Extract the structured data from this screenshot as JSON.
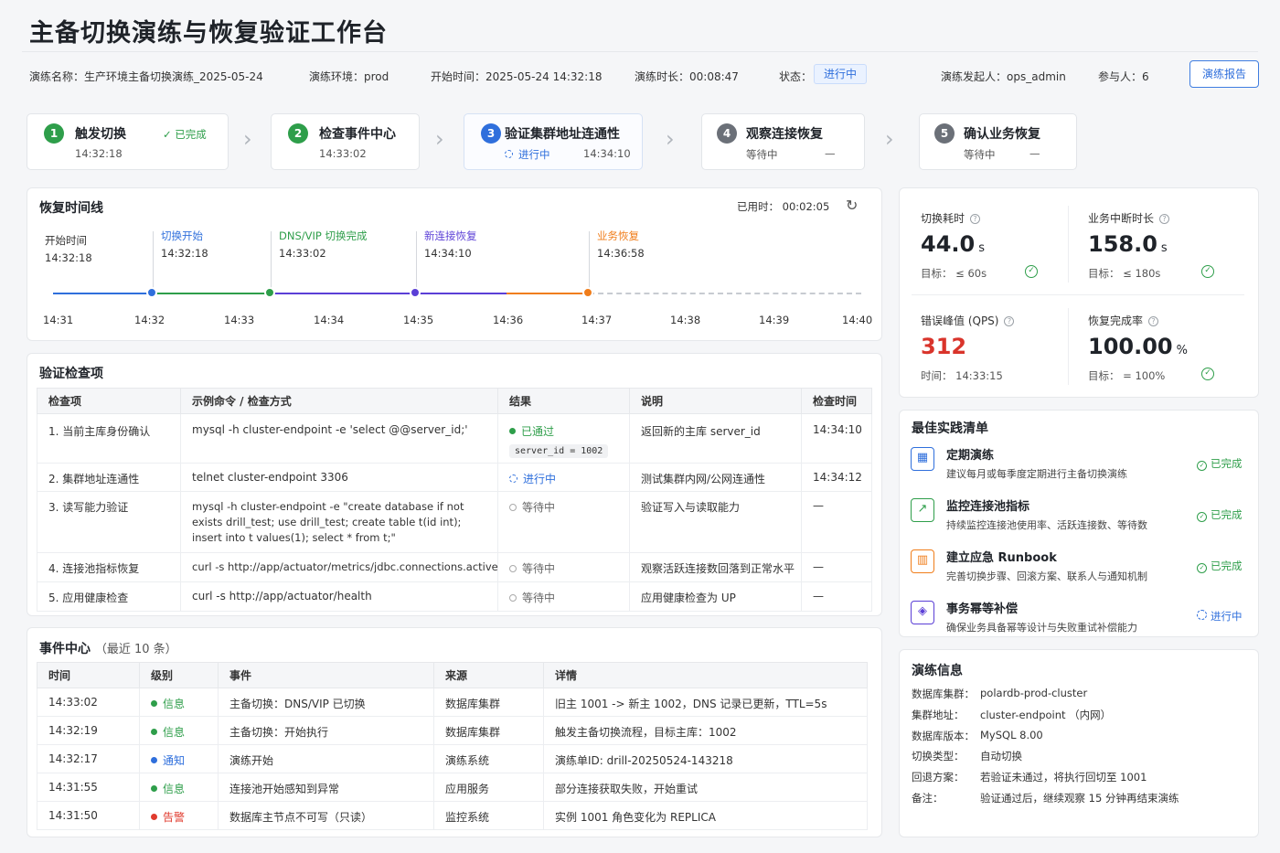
{
  "header": {
    "title": "主备切换演练与恢复验证工作台",
    "drill_name_label": "演练名称：",
    "drill_name": "生产环境主备切换演练_2025-05-24",
    "env_label": "演练环境：",
    "env": "prod",
    "start_label": "开始时间：",
    "start": "2025-05-24 14:32:18",
    "duration_label": "演练时长：",
    "duration": "00:08:47",
    "status_label": "状态：",
    "status": "进行中",
    "initiator_label": "演练发起人：",
    "initiator": "ops_admin",
    "participants_label": "参与人：",
    "participants": "6",
    "report_button": "演练报告"
  },
  "steps": [
    {
      "num": "1",
      "name": "触发切换",
      "time": "14:32:18",
      "status": "已完成",
      "color": "#2e9e4a"
    },
    {
      "num": "2",
      "name": "检查事件中心",
      "time": "14:33:02",
      "status": "",
      "color": "#2e9e4a"
    },
    {
      "num": "3",
      "name": "验证集群地址连通性",
      "status": "进行中",
      "time": "14:34:10",
      "color": "#2f6fdc"
    },
    {
      "num": "4",
      "name": "观察连接恢复",
      "status": "等待中",
      "time": "—",
      "color": "#6b7078"
    },
    {
      "num": "5",
      "name": "确认业务恢复",
      "status": "等待中",
      "time": "—",
      "color": "#6b7078"
    }
  ],
  "timeline": {
    "title": "恢复时间线",
    "elapsed_label": "已用时：",
    "elapsed": "00:02:05",
    "start_label": "开始时间",
    "start_time": "14:32:18",
    "events": [
      {
        "label": "切换开始",
        "time": "14:32:18",
        "color": "#2f6fdc"
      },
      {
        "label": "DNS/VIP 切换完成",
        "time": "14:33:02",
        "color": "#2e9e4a"
      },
      {
        "label": "新连接恢复",
        "time": "14:34:10",
        "color": "#5b3fd6"
      },
      {
        "label": "业务恢复",
        "time": "14:36:58",
        "color": "#f07d1a"
      }
    ],
    "ticks": [
      "14:31",
      "14:32",
      "14:33",
      "14:34",
      "14:35",
      "14:36",
      "14:37",
      "14:38",
      "14:39",
      "14:40"
    ]
  },
  "metrics": {
    "switch": {
      "label": "切换耗时",
      "value": "44.0",
      "unit": "s",
      "target_label": "目标：",
      "target": "≤ 60s"
    },
    "interrupt": {
      "label": "业务中断时长",
      "value": "158.0",
      "unit": "s",
      "target_label": "目标：",
      "target": "≤ 180s"
    },
    "error": {
      "label": "错误峰值 (QPS)",
      "value": "312",
      "time_label": "时间：",
      "time": "14:33:15"
    },
    "recovery": {
      "label": "恢复完成率",
      "value": "100.00",
      "unit": "%",
      "target_label": "目标：",
      "target": "= 100%"
    }
  },
  "checks": {
    "title": "验证检查项",
    "headers": [
      "检查项",
      "示例命令 / 检查方式",
      "结果",
      "说明",
      "检查时间"
    ],
    "rows": [
      {
        "item": "1. 当前主库身份确认",
        "cmd": "mysql -h cluster-endpoint -e 'select @@server_id;'",
        "result": "已通过",
        "state": "pass",
        "chip": "server_id = 1002",
        "desc": "返回新的主库 server_id",
        "time": "14:34:10"
      },
      {
        "item": "2. 集群地址连通性",
        "cmd": "telnet cluster-endpoint 3306",
        "result": "进行中",
        "state": "prog",
        "desc": "测试集群内网/公网连通性",
        "time": "14:34:12"
      },
      {
        "item": "3. 读写能力验证",
        "cmd": "mysql -h cluster-endpoint -e \"create database if not exists drill_test; use drill_test; create table t(id int); insert into t values(1); select * from t;\"",
        "result": "等待中",
        "state": "wait",
        "desc": "验证写入与读取能力",
        "time": "—"
      },
      {
        "item": "4. 连接池指标恢复",
        "cmd": "curl -s http://app/actuator/metrics/jdbc.connections.active",
        "result": "等待中",
        "state": "wait",
        "desc": "观察活跃连接数回落到正常水平",
        "time": "—"
      },
      {
        "item": "5. 应用健康检查",
        "cmd": "curl -s http://app/actuator/health",
        "result": "等待中",
        "state": "wait",
        "desc": "应用健康检查为 UP",
        "time": "—"
      }
    ]
  },
  "events": {
    "title": "事件中心",
    "subtitle": "（最近 10 条）",
    "headers": [
      "时间",
      "级别",
      "事件",
      "来源",
      "详情"
    ],
    "rows": [
      {
        "time": "14:33:02",
        "level": "信息",
        "color": "#2e9e4a",
        "event": "主备切换：DNS/VIP 已切换",
        "source": "数据库集群",
        "detail": "旧主 1001 -> 新主 1002，DNS 记录已更新，TTL=5s"
      },
      {
        "time": "14:32:19",
        "level": "信息",
        "color": "#2e9e4a",
        "event": "主备切换：开始执行",
        "source": "数据库集群",
        "detail": "触发主备切换流程，目标主库：1002"
      },
      {
        "time": "14:32:17",
        "level": "通知",
        "color": "#2f6fdc",
        "event": "演练开始",
        "source": "演练系统",
        "detail": "演练单ID: drill-20250524-143218"
      },
      {
        "time": "14:31:55",
        "level": "信息",
        "color": "#2e9e4a",
        "event": "连接池开始感知到异常",
        "source": "应用服务",
        "detail": "部分连接获取失败，开始重试"
      },
      {
        "time": "14:31:50",
        "level": "告警",
        "color": "#e03b2e",
        "event": "数据库主节点不可写（只读）",
        "source": "监控系统",
        "detail": "实例 1001 角色变化为 REPLICA"
      }
    ]
  },
  "best_practices": {
    "title": "最佳实践清单",
    "items": [
      {
        "title": "定期演练",
        "desc": "建议每月或每季度定期进行主备切换演练",
        "status": "已完成",
        "color": "#2e9e4a",
        "icon_color": "#2f6fdc",
        "icon": "calendar-icon"
      },
      {
        "title": "监控连接池指标",
        "desc": "持续监控连接池使用率、活跃连接数、等待数",
        "status": "已完成",
        "color": "#2e9e4a",
        "icon_color": "#2e9e4a",
        "icon": "chart-icon"
      },
      {
        "title": "建立应急 Runbook",
        "desc": "完善切换步骤、回滚方案、联系人与通知机制",
        "status": "已完成",
        "color": "#2e9e4a",
        "icon_color": "#f07d1a",
        "icon": "book-icon"
      },
      {
        "title": "事务幂等补偿",
        "desc": "确保业务具备幂等设计与失败重试补偿能力",
        "status": "进行中",
        "color": "#2f6fdc",
        "icon_color": "#5b3fd6",
        "icon": "shield-icon"
      }
    ]
  },
  "drill_info": {
    "title": "演练信息",
    "rows": [
      {
        "k": "数据库集群：",
        "v": "polardb-prod-cluster"
      },
      {
        "k": "集群地址：",
        "v": "cluster-endpoint （内网）"
      },
      {
        "k": "数据库版本：",
        "v": "MySQL 8.00"
      },
      {
        "k": "切换类型：",
        "v": "自动切换"
      },
      {
        "k": "回退方案：",
        "v": "若验证未通过，将执行回切至 1001"
      },
      {
        "k": "备注：",
        "v": "验证通过后，继续观察 15 分钟再结束演练"
      }
    ]
  }
}
